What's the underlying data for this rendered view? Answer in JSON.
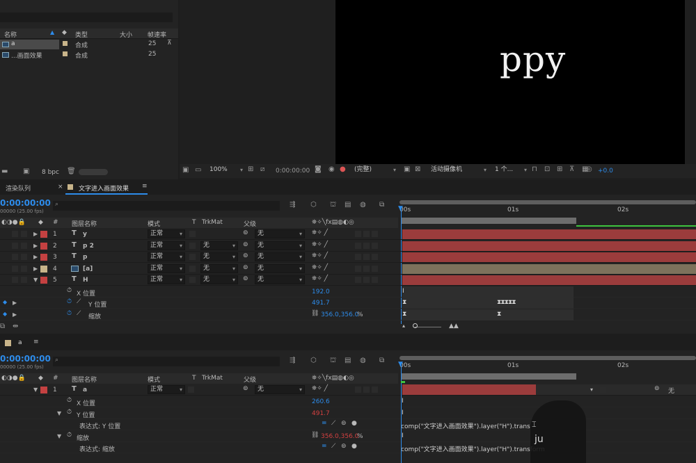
{
  "project": {
    "columns": {
      "name": "名称",
      "type": "类型",
      "size": "大小",
      "fps": "帧速率"
    },
    "items": [
      {
        "name": "a",
        "type": "合成",
        "fps": "25",
        "color": "#c8b48a"
      },
      {
        "name": "...画面效果",
        "type": "合成",
        "fps": "25",
        "color": "#c8b48a"
      }
    ],
    "footer_bpc": "8 bpc"
  },
  "viewer": {
    "preview_text": "ppy",
    "zoom": "100%",
    "timecode": "0:00:00:00",
    "resolution": "(完整)",
    "camera": "活动摄像机",
    "views": "1 个...",
    "exposure": "+0.0"
  },
  "tabs": {
    "render_queue": "渲染队列",
    "comp_tab": "文字进入画面效果"
  },
  "timeline1": {
    "timecode": "0:00:00:00",
    "fps_note": "00000 (25.00 fps)",
    "search_placeholder": "",
    "headers": {
      "layer_name": "图层名称",
      "mode": "模式",
      "t": "T",
      "trkmat": "TrkMat",
      "parent": "父级"
    },
    "ruler": [
      "00s",
      "01s",
      "02s"
    ],
    "layers": [
      {
        "num": "1",
        "type": "T",
        "name": "y",
        "mode": "正常",
        "trkmat": "",
        "parent": "无",
        "color": "#c44141",
        "bar": "#9b3c3c"
      },
      {
        "num": "2",
        "type": "T",
        "name": "p 2",
        "mode": "正常",
        "trkmat": "无",
        "parent": "无",
        "color": "#c44141",
        "bar": "#9b3c3c"
      },
      {
        "num": "3",
        "type": "T",
        "name": "p",
        "mode": "正常",
        "trkmat": "无",
        "parent": "无",
        "color": "#c44141",
        "bar": "#9b3c3c"
      },
      {
        "num": "4",
        "type": "img",
        "name": "[a]",
        "mode": "正常",
        "trkmat": "无",
        "parent": "无",
        "color": "#c8b48a",
        "bar": "#7d725c"
      },
      {
        "num": "5",
        "type": "T",
        "name": "H",
        "mode": "正常",
        "trkmat": "无",
        "parent": "无",
        "color": "#c44141",
        "bar": "#9b3c3c"
      }
    ],
    "props": [
      {
        "name": "X 位置",
        "value": "192.0"
      },
      {
        "name": "Y 位置",
        "value": "491.7"
      },
      {
        "name": "缩放",
        "value": "356.0,356.0",
        "unit": "%"
      }
    ]
  },
  "timeline2": {
    "comp_name": "a",
    "timecode": "0:00:00:00",
    "fps_note": "00000 (25.00 fps)",
    "headers": {
      "layer_name": "图层名称",
      "mode": "模式",
      "t": "T",
      "trkmat": "TrkMat",
      "parent": "父级"
    },
    "ruler": [
      "00s",
      "01s",
      "02s"
    ],
    "layer": {
      "num": "1",
      "type": "T",
      "name": "a",
      "mode": "正常",
      "parent": "无",
      "color": "#c44141"
    },
    "props": [
      {
        "name": "X 位置",
        "value": "260.6"
      },
      {
        "name": "Y 位置",
        "value": "491.7"
      },
      {
        "name": "表达式: Y 位置",
        "expr": "comp(\"文字进入画面效果\").layer(\"H\").trans"
      },
      {
        "name": "缩放",
        "value": "356.0,356.0",
        "unit": "%"
      },
      {
        "name": "表达式: 缩放",
        "expr": "comp(\"文字进入画面效果\").layer(\"H\").transform"
      }
    ],
    "overlay_parent": "无",
    "cursor_glyph": "ju"
  }
}
